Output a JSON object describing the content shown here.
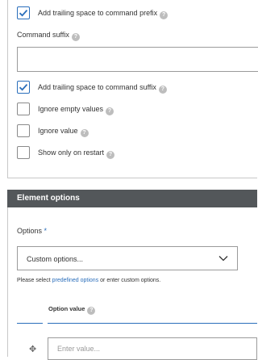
{
  "command_options": {
    "prefix_trailing_space": {
      "label": "Add trailing space to command prefix",
      "checked": true
    },
    "command_suffix": {
      "label": "Command suffix",
      "value": ""
    },
    "suffix_trailing_space": {
      "label": "Add trailing space to command suffix",
      "checked": true
    },
    "ignore_empty_values": {
      "label": "Ignore empty values",
      "checked": false
    },
    "ignore_value": {
      "label": "Ignore value",
      "checked": false
    },
    "show_only_on_restart": {
      "label": "Show only on restart",
      "checked": false
    }
  },
  "element_options": {
    "title": "Element options",
    "options_label": "Options",
    "required_marker": "*",
    "select_value": "Custom options...",
    "hint_prefix": "Please select ",
    "hint_link": "predefined options",
    "hint_suffix": " or enter custom options.",
    "column_header": "Option value",
    "value_placeholder": "Enter value...",
    "drag_handle": "✥"
  },
  "help_icon": "?",
  "colors": {
    "accent": "#2a6ebb",
    "section_header_bg": "#53575a",
    "required_star": "#2a6ebb"
  }
}
